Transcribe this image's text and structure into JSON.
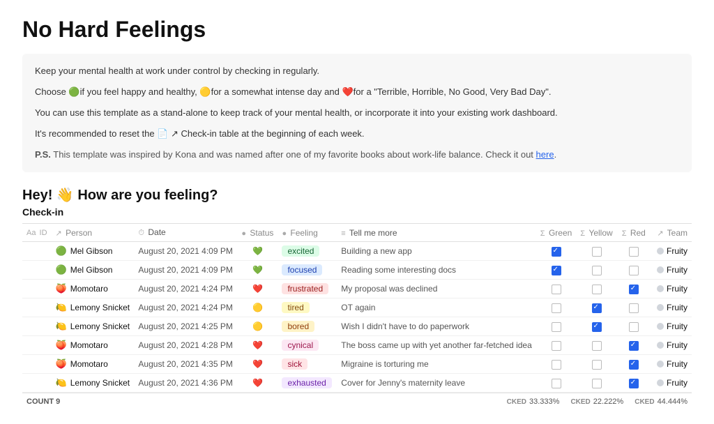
{
  "page": {
    "title": "No Hard Feelings",
    "description": {
      "line1": "Keep your mental health at work under control by checking in regularly.",
      "line2_pre": "Choose ",
      "line2_green": "🟢",
      "line2_green_text": "if you feel happy and healthy, ",
      "line2_yellow": "🟡",
      "line2_yellow_text": "for a somewhat intense day and ",
      "line2_red": "❤️",
      "line2_red_text": "for a \"Terrible, Horrible, No Good, Very Bad Day\".",
      "line3": "You can use this template as a stand-alone to keep track of your mental health, or incorporate it into your existing work dashboard.",
      "line4": "It's recommended to reset the 📄 ↗ Check-in table at the beginning of each week.",
      "ps": "P.S. This template was inspired by Kona and was named after one of my favorite books about work-life balance. Check it out here."
    },
    "section_heading": "Hey! 👋 How are you feeling?",
    "table_title": "Check-in"
  },
  "table": {
    "headers": [
      {
        "id": "col-id",
        "icon": "Aa",
        "label": "ID"
      },
      {
        "id": "col-person",
        "icon": "↗",
        "label": "Person"
      },
      {
        "id": "col-date",
        "icon": "⏱",
        "label": "Date"
      },
      {
        "id": "col-status",
        "icon": "●",
        "label": "Status"
      },
      {
        "id": "col-feeling",
        "icon": "●",
        "label": "Feeling"
      },
      {
        "id": "col-tell",
        "icon": "≡",
        "label": "Tell me more"
      },
      {
        "id": "col-green",
        "icon": "Σ",
        "label": "Green"
      },
      {
        "id": "col-yellow",
        "icon": "Σ",
        "label": "Yellow"
      },
      {
        "id": "col-red",
        "icon": "Σ",
        "label": "Red"
      },
      {
        "id": "col-team",
        "icon": "↗",
        "label": "Team"
      }
    ],
    "rows": [
      {
        "id": "",
        "person": "Mel Gibson",
        "person_emoji": "🟢",
        "date": "August 20, 2021 4:09 PM",
        "status": "💚",
        "feeling": "excited",
        "feeling_class": "feeling-excited",
        "tell": "Building a new app",
        "green": true,
        "yellow": false,
        "red": false,
        "team": "Fruity"
      },
      {
        "id": "",
        "person": "Mel Gibson",
        "person_emoji": "🟢",
        "date": "August 20, 2021 4:09 PM",
        "status": "💚",
        "feeling": "focused",
        "feeling_class": "feeling-focused",
        "tell": "Reading some interesting docs",
        "green": true,
        "yellow": false,
        "red": false,
        "team": "Fruity"
      },
      {
        "id": "",
        "person": "Momotaro",
        "person_emoji": "🍑",
        "date": "August 20, 2021 4:24 PM",
        "status": "❤️",
        "feeling": "frustrated",
        "feeling_class": "feeling-frustrated",
        "tell": "My proposal was declined",
        "green": false,
        "yellow": false,
        "red": true,
        "team": "Fruity"
      },
      {
        "id": "",
        "person": "Lemony Snicket",
        "person_emoji": "🍋",
        "date": "August 20, 2021 4:24 PM",
        "status": "🟡",
        "feeling": "tired",
        "feeling_class": "feeling-tired",
        "tell": "OT again",
        "green": false,
        "yellow": true,
        "red": false,
        "team": "Fruity"
      },
      {
        "id": "",
        "person": "Lemony Snicket",
        "person_emoji": "🍋",
        "date": "August 20, 2021 4:25 PM",
        "status": "🟡",
        "feeling": "bored",
        "feeling_class": "feeling-bored",
        "tell": "Wish I didn't have to do paperwork",
        "green": false,
        "yellow": true,
        "red": false,
        "team": "Fruity"
      },
      {
        "id": "",
        "person": "Momotaro",
        "person_emoji": "🍑",
        "date": "August 20, 2021 4:28 PM",
        "status": "❤️",
        "feeling": "cynical",
        "feeling_class": "feeling-cynical",
        "tell": "The boss came up with yet another far-fetched idea",
        "green": false,
        "yellow": false,
        "red": true,
        "team": "Fruity"
      },
      {
        "id": "",
        "person": "Momotaro",
        "person_emoji": "🍑",
        "date": "August 20, 2021 4:35 PM",
        "status": "❤️",
        "feeling": "sick",
        "feeling_class": "feeling-sick",
        "tell": "Migraine is torturing me",
        "green": false,
        "yellow": false,
        "red": true,
        "team": "Fruity"
      },
      {
        "id": "",
        "person": "Lemony Snicket",
        "person_emoji": "🍋",
        "date": "August 20, 2021 4:36 PM",
        "status": "❤️",
        "feeling": "exhausted",
        "feeling_class": "feeling-exhausted",
        "tell": "Cover for Jenny's maternity leave",
        "green": false,
        "yellow": false,
        "red": true,
        "team": "Fruity"
      }
    ],
    "footer": {
      "count_label": "COUNT",
      "count_value": "9",
      "stats": [
        {
          "label": "CKED",
          "value": "33.333%"
        },
        {
          "label": "CKED",
          "value": "22.222%"
        },
        {
          "label": "CKED",
          "value": "44.444%"
        }
      ]
    }
  }
}
